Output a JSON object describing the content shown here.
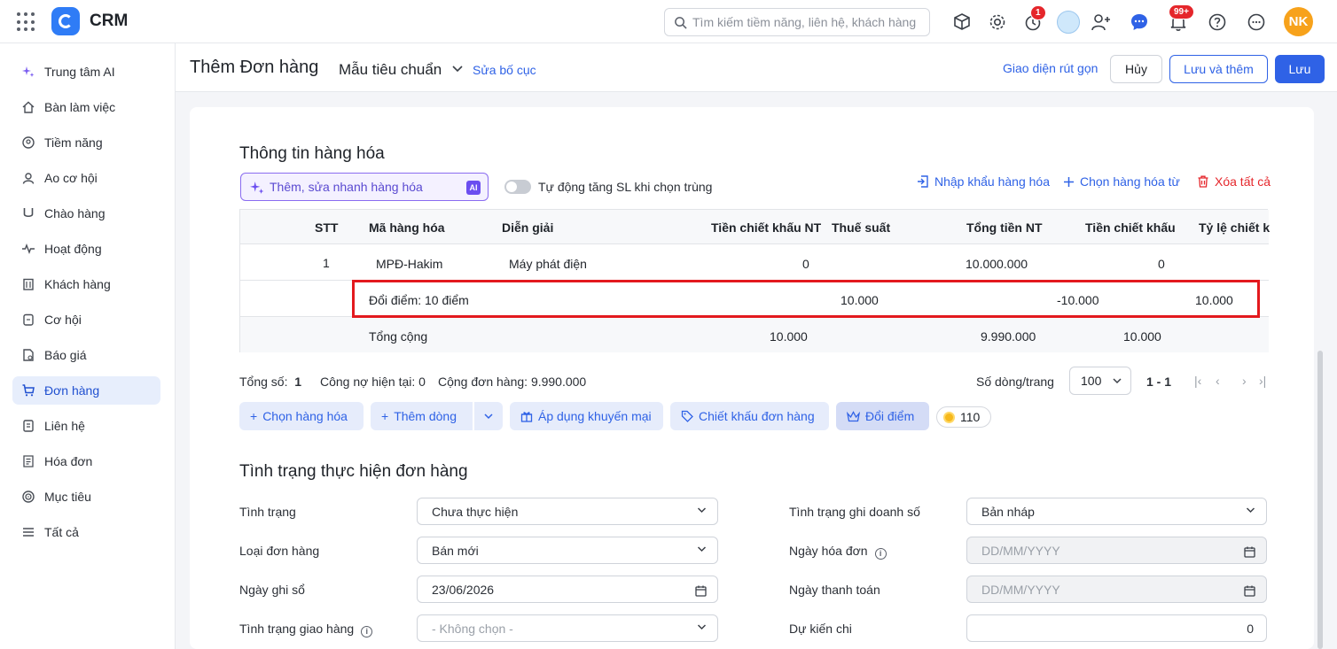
{
  "app": {
    "title": "CRM"
  },
  "search": {
    "placeholder": "Tìm kiếm tiềm năng, liên hệ, khách hàng"
  },
  "topbar": {
    "timer_badge": "1",
    "notification_badge": "99+",
    "avatar_initials": "NK"
  },
  "sidebar": {
    "items": [
      {
        "label": "Trung tâm AI",
        "icon": "sparkle-icon"
      },
      {
        "label": "Bàn làm việc",
        "icon": "home-icon"
      },
      {
        "label": "Tiềm năng",
        "icon": "prospect-icon"
      },
      {
        "label": "Ao cơ hội",
        "icon": "users-icon"
      },
      {
        "label": "Chào hàng",
        "icon": "magnet-icon"
      },
      {
        "label": "Hoạt động",
        "icon": "activity-icon"
      },
      {
        "label": "Khách hàng",
        "icon": "building-icon"
      },
      {
        "label": "Cơ hội",
        "icon": "opportunity-icon"
      },
      {
        "label": "Báo giá",
        "icon": "quote-icon"
      },
      {
        "label": "Đơn hàng",
        "icon": "cart-icon",
        "active": true
      },
      {
        "label": "Liên hệ",
        "icon": "contact-icon"
      },
      {
        "label": "Hóa đơn",
        "icon": "invoice-icon"
      },
      {
        "label": "Mục tiêu",
        "icon": "target-icon"
      },
      {
        "label": "Tất cả",
        "icon": "menu-icon"
      }
    ]
  },
  "header": {
    "title": "Thêm Đơn hàng",
    "template": "Mẫu tiêu chuẩn",
    "edit_layout": "Sửa bố cục",
    "compact_view": "Giao diện rút gọn",
    "cancel": "Hủy",
    "save_and_add": "Lưu và thêm",
    "save": "Lưu"
  },
  "goods": {
    "title": "Thông tin hàng hóa",
    "ai_placeholder": "Thêm, sửa nhanh hàng hóa",
    "ai_tag": "AI",
    "auto_increase": "Tự động tăng SL khi chọn trùng",
    "import": "Nhập khẩu hàng hóa",
    "choose_from": "Chọn hàng hóa từ",
    "delete_all": "Xóa tất cả",
    "columns": [
      "STT",
      "Mã hàng hóa",
      "Diễn giải",
      "Tiền chiết khấu NT",
      "Thuế suất",
      "Tổng tiền NT",
      "Tiền chiết khấu",
      "Tỷ lệ chiết k"
    ],
    "row": {
      "stt": "1",
      "code": "MPĐ-Hakim",
      "desc": "Máy phát điện",
      "discount_nt": "0",
      "total_nt": "10.000.000",
      "discount": "0"
    },
    "points_row": {
      "label": "Đổi điểm: 10 điểm",
      "v1": "10.000",
      "v2": "-10.000",
      "v3": "10.000"
    },
    "total_row": {
      "label": "Tổng cộng",
      "discount_nt": "10.000",
      "total_nt": "9.990.000",
      "discount": "10.000"
    },
    "summary": {
      "count_label": "Tổng số:",
      "count": "1",
      "debt": "Công nợ hiện tại: 0",
      "order_total_label": "Cộng đơn hàng:",
      "order_total": "9.990.000"
    },
    "paging": {
      "rows_label": "Số dòng/trang",
      "rows": "100",
      "range": "1 - 1"
    },
    "actions": {
      "choose": "Chọn hàng hóa",
      "add_row": "Thêm dòng",
      "promo": "Áp dụng khuyến mại",
      "discount": "Chiết khấu đơn hàng",
      "points": "Đổi điểm",
      "coins": "110"
    }
  },
  "status": {
    "title": "Tình trạng thực hiện đơn hàng",
    "fields": {
      "status": {
        "label": "Tình trạng",
        "value": "Chưa thực hiện"
      },
      "order_type": {
        "label": "Loại đơn hàng",
        "value": "Bán mới"
      },
      "record_date": {
        "label": "Ngày ghi sổ",
        "value": "23/06/2026"
      },
      "delivery": {
        "label": "Tình trạng giao hàng",
        "value": "- Không chọn -"
      },
      "revenue_status": {
        "label": "Tình trạng ghi doanh số",
        "value": "Bản nháp"
      },
      "invoice_date": {
        "label": "Ngày hóa đơn",
        "placeholder": "DD/MM/YYYY"
      },
      "payment_date": {
        "label": "Ngày thanh toán",
        "placeholder": "DD/MM/YYYY"
      },
      "expected": {
        "label": "Dự kiến chi",
        "value": "0"
      }
    }
  },
  "colors": {
    "accent": "#2f62e6",
    "danger": "#e5262b",
    "highlight_border": "#e3191e",
    "avatar": "#f7a21b"
  }
}
